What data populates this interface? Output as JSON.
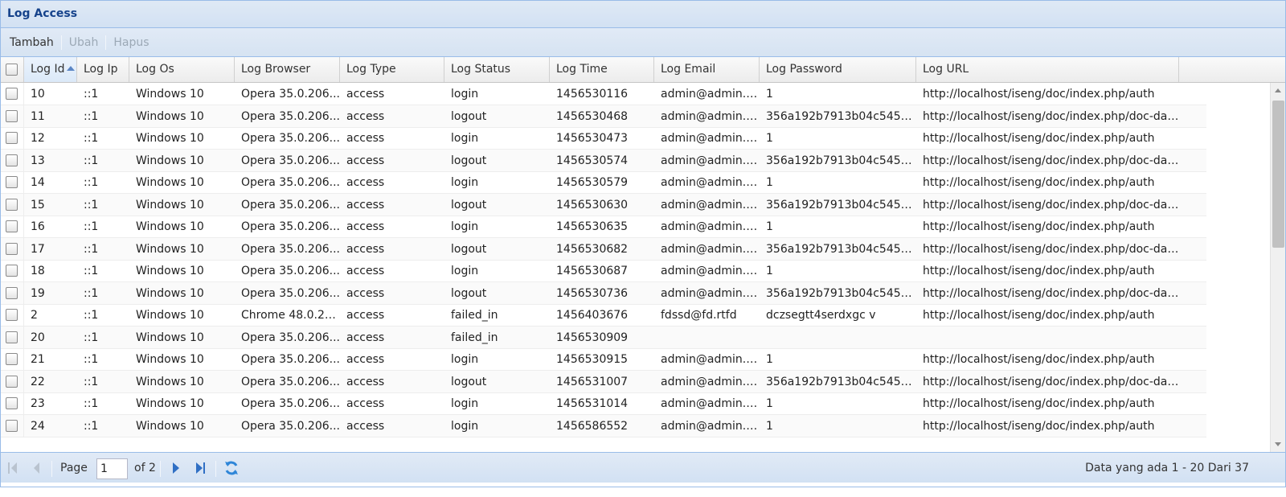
{
  "panel": {
    "title": "Log Access"
  },
  "toolbar": {
    "add_label": "Tambah",
    "edit_label": "Ubah",
    "delete_label": "Hapus"
  },
  "columns": [
    "Log Id",
    "Log Ip",
    "Log Os",
    "Log Browser",
    "Log Type",
    "Log Status",
    "Log Time",
    "Log Email",
    "Log Password",
    "Log URL"
  ],
  "sort": {
    "column": "Log Id",
    "direction": "ascending"
  },
  "rows": [
    [
      "10",
      "::1",
      "Windows 10",
      "Opera 35.0.206...",
      "access",
      "login",
      "1456530116",
      "admin@admin.c...",
      "1",
      "http://localhost/iseng/doc/index.php/auth"
    ],
    [
      "11",
      "::1",
      "Windows 10",
      "Opera 35.0.206...",
      "access",
      "logout",
      "1456530468",
      "admin@admin.c...",
      "356a192b7913b04c54574...",
      "http://localhost/iseng/doc/index.php/doc-dash..."
    ],
    [
      "12",
      "::1",
      "Windows 10",
      "Opera 35.0.206...",
      "access",
      "login",
      "1456530473",
      "admin@admin.c...",
      "1",
      "http://localhost/iseng/doc/index.php/auth"
    ],
    [
      "13",
      "::1",
      "Windows 10",
      "Opera 35.0.206...",
      "access",
      "logout",
      "1456530574",
      "admin@admin.c...",
      "356a192b7913b04c54574...",
      "http://localhost/iseng/doc/index.php/doc-dash..."
    ],
    [
      "14",
      "::1",
      "Windows 10",
      "Opera 35.0.206...",
      "access",
      "login",
      "1456530579",
      "admin@admin.c...",
      "1",
      "http://localhost/iseng/doc/index.php/auth"
    ],
    [
      "15",
      "::1",
      "Windows 10",
      "Opera 35.0.206...",
      "access",
      "logout",
      "1456530630",
      "admin@admin.c...",
      "356a192b7913b04c54574...",
      "http://localhost/iseng/doc/index.php/doc-dash..."
    ],
    [
      "16",
      "::1",
      "Windows 10",
      "Opera 35.0.206...",
      "access",
      "login",
      "1456530635",
      "admin@admin.c...",
      "1",
      "http://localhost/iseng/doc/index.php/auth"
    ],
    [
      "17",
      "::1",
      "Windows 10",
      "Opera 35.0.206...",
      "access",
      "logout",
      "1456530682",
      "admin@admin.c...",
      "356a192b7913b04c54574...",
      "http://localhost/iseng/doc/index.php/doc-dash..."
    ],
    [
      "18",
      "::1",
      "Windows 10",
      "Opera 35.0.206...",
      "access",
      "login",
      "1456530687",
      "admin@admin.c...",
      "1",
      "http://localhost/iseng/doc/index.php/auth"
    ],
    [
      "19",
      "::1",
      "Windows 10",
      "Opera 35.0.206...",
      "access",
      "logout",
      "1456530736",
      "admin@admin.c...",
      "356a192b7913b04c54574...",
      "http://localhost/iseng/doc/index.php/doc-dash..."
    ],
    [
      "2",
      "::1",
      "Windows 10",
      "Chrome 48.0.25...",
      "access",
      "failed_in",
      "1456403676",
      "fdssd@fd.rtfd",
      "dczsegtt4serdxgc v",
      "http://localhost/iseng/doc/index.php/auth"
    ],
    [
      "20",
      "::1",
      "Windows 10",
      "Opera 35.0.206...",
      "access",
      "failed_in",
      "1456530909",
      "",
      "",
      ""
    ],
    [
      "21",
      "::1",
      "Windows 10",
      "Opera 35.0.206...",
      "access",
      "login",
      "1456530915",
      "admin@admin.c...",
      "1",
      "http://localhost/iseng/doc/index.php/auth"
    ],
    [
      "22",
      "::1",
      "Windows 10",
      "Opera 35.0.206...",
      "access",
      "logout",
      "1456531007",
      "admin@admin.c...",
      "356a192b7913b04c54574...",
      "http://localhost/iseng/doc/index.php/doc-dash..."
    ],
    [
      "23",
      "::1",
      "Windows 10",
      "Opera 35.0.206...",
      "access",
      "login",
      "1456531014",
      "admin@admin.c...",
      "1",
      "http://localhost/iseng/doc/index.php/auth"
    ],
    [
      "24",
      "::1",
      "Windows 10",
      "Opera 35.0.206...",
      "access",
      "login",
      "1456586552",
      "admin@admin.c...",
      "1",
      "http://localhost/iseng/doc/index.php/auth"
    ]
  ],
  "pager": {
    "page_label": "Page",
    "page_value": "1",
    "of_label": "of 2",
    "display_msg": "Data yang ada 1 - 20 Dari 37"
  },
  "colors": {
    "accent": "#15428b",
    "header_bg": "#d2e1f3",
    "border": "#99bce8"
  },
  "icons": [
    "first-page-icon",
    "prev-page-icon",
    "next-page-icon",
    "last-page-icon",
    "refresh-icon",
    "sort-ascending-icon"
  ]
}
